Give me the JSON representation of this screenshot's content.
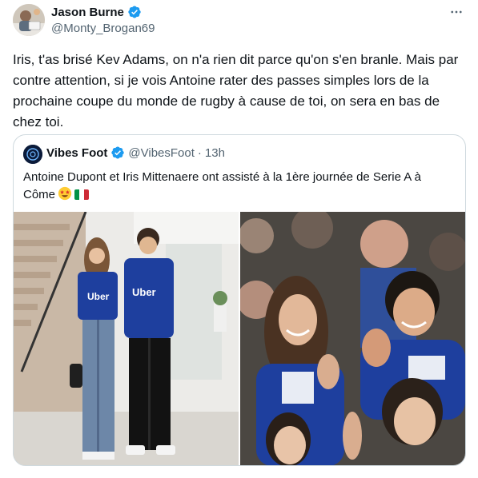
{
  "author": {
    "display_name": "Jason Burne",
    "handle": "@Monty_Brogan69",
    "verified": true
  },
  "tweet": {
    "text": "Iris, t'as brisé Kev Adams, on n'a rien dit parce qu'on s'en branle. Mais par contre attention, si je vois Antoine rater des passes simples lors de la prochaine coupe du monde de rugby à cause de toi, on sera en bas de chez toi."
  },
  "quoted_tweet": {
    "display_name": "Vibes Foot",
    "handle": "@VibesFoot",
    "separator": "·",
    "time": "13h",
    "text": "Antoine Dupont et Iris Mittenaere ont assisté à la 1ère journée de Serie A à Côme",
    "emoji": "star-struck-emoji",
    "flag": "italy-flag"
  },
  "icons": {
    "verified": "verified-badge-icon",
    "more": "more-options-icon"
  },
  "colors": {
    "verified_blue": "#1d9bf0",
    "text_primary": "#0f1419",
    "text_secondary": "#536471",
    "border": "#cfd9de",
    "jersey_blue": "#1e3f9e"
  }
}
